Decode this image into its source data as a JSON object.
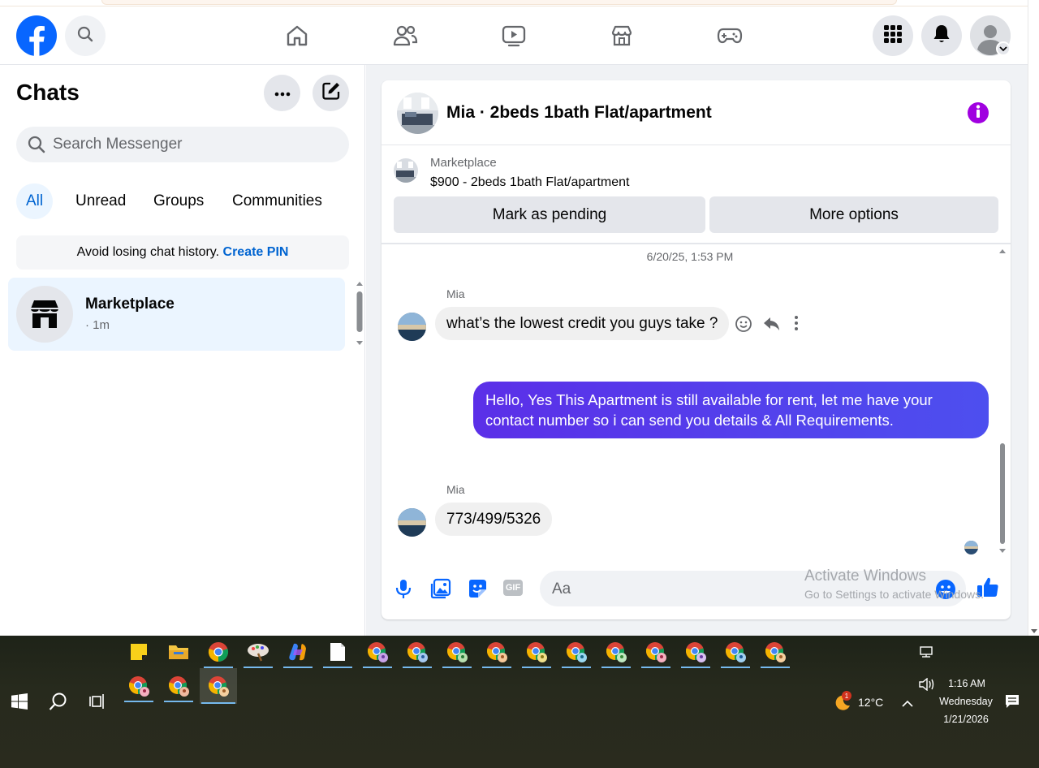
{
  "navbar": {
    "logo": "facebook-logo",
    "search_icon": "search-icon",
    "nav_icons": [
      "home-icon",
      "friends-icon",
      "video-icon",
      "marketplace-icon",
      "gaming-icon"
    ],
    "right_icons": [
      "menu-grid-icon",
      "notifications-bell-icon",
      "account-avatar"
    ]
  },
  "sidebar": {
    "title": "Chats",
    "search_placeholder": "Search Messenger",
    "filters": [
      {
        "label": "All",
        "active": true
      },
      {
        "label": "Unread",
        "active": false
      },
      {
        "label": "Groups",
        "active": false
      },
      {
        "label": "Communities",
        "active": false
      }
    ],
    "pin_banner": {
      "text": "Avoid losing chat history.",
      "link": "Create PIN"
    },
    "chats": [
      {
        "name": "Marketplace",
        "meta": "· 1m",
        "icon": "store-icon"
      }
    ]
  },
  "conversation": {
    "title": "Mia · 2beds 1bath Flat/apartment",
    "listing": {
      "source": "Marketplace",
      "title": "$900 - 2beds 1bath Flat/apartment",
      "actions": [
        "Mark as pending",
        "More options"
      ]
    },
    "timestamp": "6/20/25, 1:53 PM",
    "messages": [
      {
        "sender": "Mia",
        "direction": "in",
        "text": "what’s the lowest credit you guys take ?"
      },
      {
        "sender": "You",
        "direction": "out",
        "text": "Hello, Yes This Apartment is still available for rent, let me have your contact number so i can send you details & All Requirements."
      },
      {
        "sender": "Mia",
        "direction": "in",
        "text": "773/499/5326"
      }
    ],
    "composer_placeholder": "Aa",
    "accent_color": "#6a1bd9"
  },
  "watermark": {
    "line1": "Activate Windows",
    "line2": "Go to Settings to activate Windows."
  },
  "taskbar": {
    "time": "1:16 AM",
    "day": "Wednesday",
    "date": "1/21/2026",
    "temperature": "12°C",
    "weather_badge": "1"
  }
}
